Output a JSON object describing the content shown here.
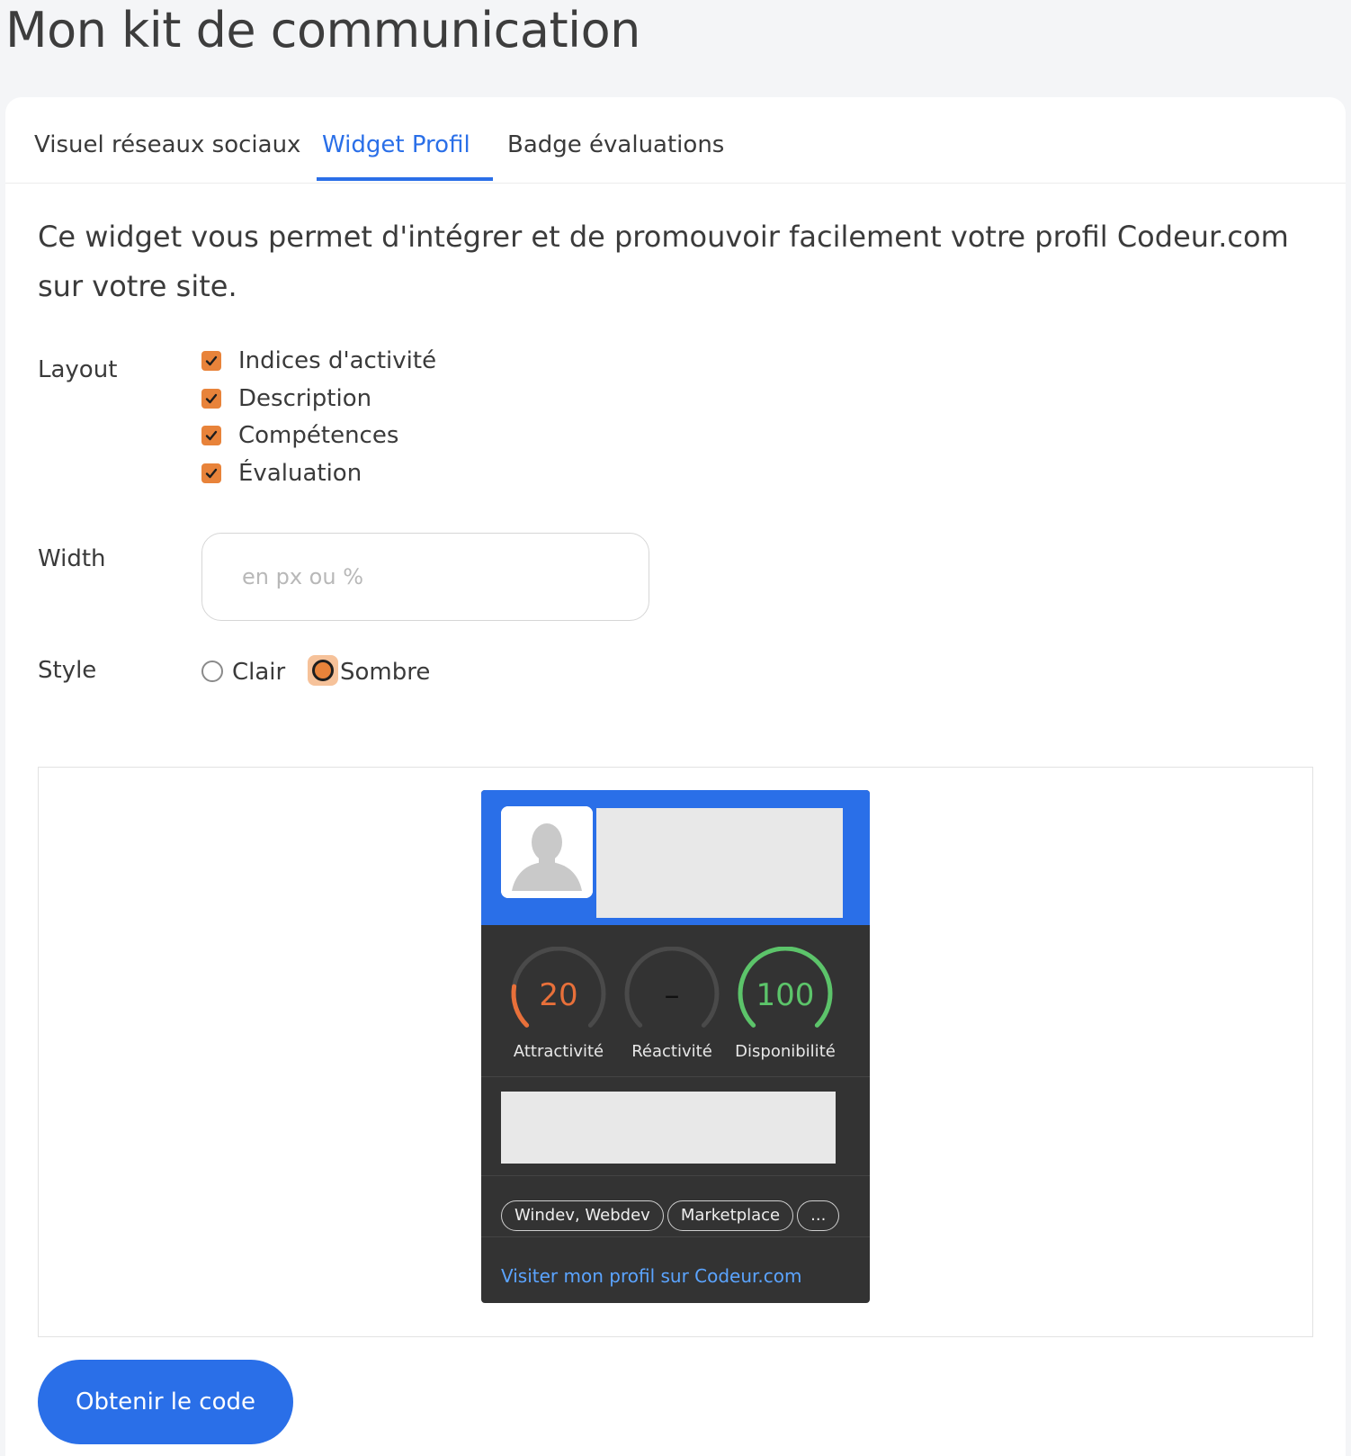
{
  "page": {
    "title": "Mon kit de communication"
  },
  "tabs": [
    {
      "label": "Visuel réseaux sociaux",
      "active": false
    },
    {
      "label": "Widget Profil",
      "active": true
    },
    {
      "label": "Badge évaluations",
      "active": false
    }
  ],
  "intro": "Ce widget vous permet d'intégrer et de promouvoir facilement votre profil Codeur.com sur votre site.",
  "form": {
    "layout_label": "Layout",
    "layout_options": [
      {
        "label": "Indices d'activité",
        "checked": true
      },
      {
        "label": "Description",
        "checked": true
      },
      {
        "label": "Compétences",
        "checked": true
      },
      {
        "label": "Évaluation",
        "checked": true
      }
    ],
    "width_label": "Width",
    "width_value": "",
    "width_placeholder": "en px ou %",
    "style_label": "Style",
    "style_options": [
      {
        "label": "Clair",
        "selected": false
      },
      {
        "label": "Sombre",
        "selected": true
      }
    ]
  },
  "widget": {
    "metrics": [
      {
        "value": "20",
        "label": "Attractivité",
        "fraction": 0.2,
        "color": "#e8703a"
      },
      {
        "value": "–",
        "label": "Réactivité",
        "fraction": 0,
        "color": "#111111"
      },
      {
        "value": "100",
        "label": "Disponibilité",
        "fraction": 1.0,
        "color": "#5cc46a"
      }
    ],
    "skills": [
      "Windev, Webdev",
      "Marketplace",
      "..."
    ],
    "profile_link": "Visiter mon profil sur Codeur.com"
  },
  "cta": {
    "label": "Obtenir le code"
  },
  "colors": {
    "accent": "#2a6fe8",
    "checkbox": "#e8833a",
    "widget_bg": "#333333"
  }
}
